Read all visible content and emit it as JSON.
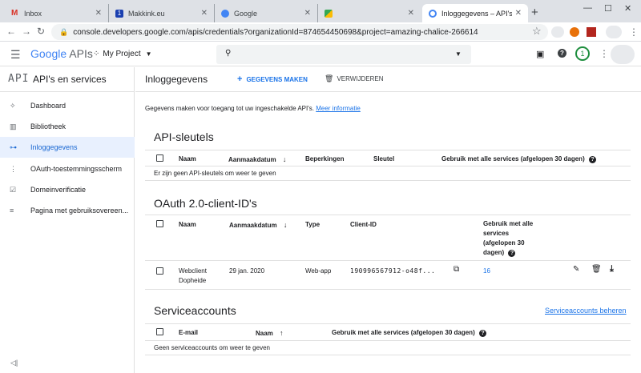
{
  "browser": {
    "tabs": [
      {
        "title": "Inbox",
        "favicon_color": "#d93025",
        "favicon_glyph": "M"
      },
      {
        "title": "Makkink.eu",
        "favicon_color": "#1a3fb0",
        "favicon_glyph": "1"
      },
      {
        "title": "Google",
        "favicon_color": "#4285f4",
        "favicon_glyph": "G"
      },
      {
        "title": "",
        "favicon_color": "#34a853",
        "favicon_glyph": "map-icon"
      },
      {
        "title": "Inloggegevens – API's en",
        "favicon_color": "#4285f4",
        "favicon_glyph": "G"
      }
    ],
    "new_tab": "+",
    "url": "console.developers.google.com/apis/credentials?organizationId=874654450698&project=amazing-chalice-266614"
  },
  "header": {
    "brand_google": "Google",
    "brand_apis": "APIs",
    "project": "My Project",
    "notification_count": "1"
  },
  "sidebar": {
    "api_logo": "API",
    "title": "API's en services",
    "items": [
      {
        "label": "Dashboard",
        "icon": "dashboard-icon",
        "glyph": "✧"
      },
      {
        "label": "Bibliotheek",
        "icon": "library-icon",
        "glyph": "▥"
      },
      {
        "label": "Inloggegevens",
        "icon": "key-icon",
        "glyph": "⊶",
        "active": true
      },
      {
        "label": "OAuth-toestemmingsscherm",
        "icon": "consent-icon",
        "glyph": "⋮"
      },
      {
        "label": "Domeinverificatie",
        "icon": "domain-check-icon",
        "glyph": "☑"
      },
      {
        "label": "Pagina met gebruiksovereen...",
        "icon": "settings-icon",
        "glyph": "≡"
      }
    ],
    "collapse": "◁|"
  },
  "main": {
    "page_title": "Inloggegevens",
    "create_label": "GEGEVENS MAKEN",
    "delete_label": "VERWIJDEREN",
    "intro": "Gegevens maken voor toegang tot uw ingeschakelde API's.",
    "intro_link": "Meer informatie",
    "api_keys": {
      "title": "API-sleutels",
      "headers": [
        "Naam",
        "Aanmaakdatum",
        "Beperkingen",
        "Sleutel",
        "Gebruik met alle services (afgelopen 30 dagen)"
      ],
      "empty": "Er zijn geen API-sleutels om weer te geven"
    },
    "oauth": {
      "title": "OAuth 2.0-client-ID's",
      "headers": [
        "Naam",
        "Aanmaakdatum",
        "Type",
        "Client-ID"
      ],
      "usage_header_lines": [
        "Gebruik met alle",
        "services",
        "(afgelopen 30",
        "dagen)"
      ],
      "row": {
        "name_lines": [
          "Webclient",
          "Dopheide"
        ],
        "date": "29 jan. 2020",
        "type": "Web-app",
        "client_id": "190996567912-o48f...",
        "usage": "16"
      }
    },
    "service_accounts": {
      "title": "Serviceaccounts",
      "manage_link": "Serviceaccounts beheren",
      "headers": [
        "E-mail",
        "Naam",
        "Gebruik met alle services (afgelopen 30 dagen)"
      ],
      "empty": "Geen serviceaccounts om weer te geven"
    }
  }
}
